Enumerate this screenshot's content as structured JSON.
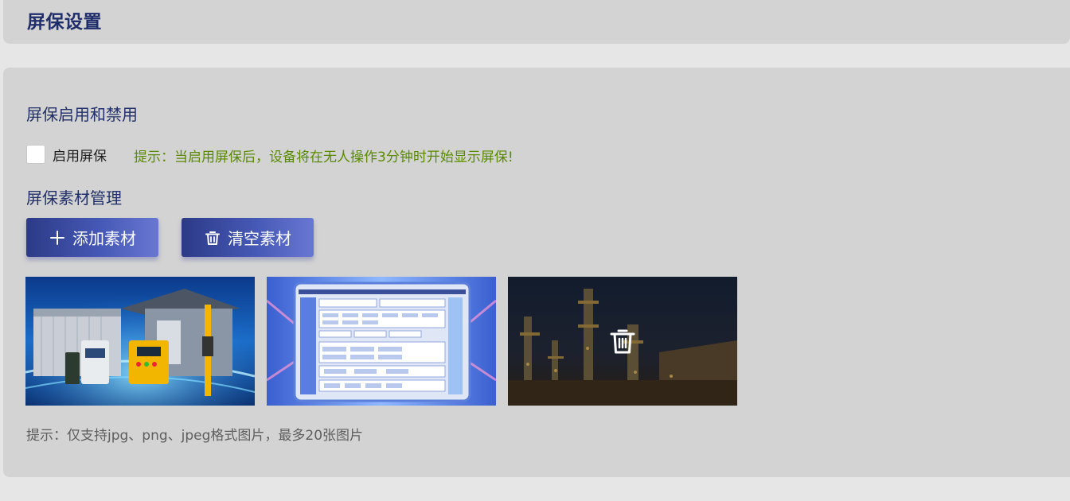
{
  "header": {
    "title": "屏保设置"
  },
  "enable_section": {
    "title": "屏保启用和禁用",
    "checkbox_label": "启用屏保",
    "checked": false,
    "tip": "提示：当启用屏保后，设备将在无人操作3分钟时开始显示屏保!"
  },
  "material_section": {
    "title": "屏保素材管理",
    "add_button": "添加素材",
    "clear_button": "清空素材",
    "images": [
      {
        "icon": "industrial-equipment-image"
      },
      {
        "icon": "platform-architecture-image"
      },
      {
        "icon": "refinery-night-image",
        "hover_icon": "trash-icon"
      }
    ],
    "tip": "提示：仅支持jpg、png、jpeg格式图片，最多20张图片"
  },
  "colors": {
    "title": "#1f2d6b",
    "tip_green": "#5a8a00",
    "button_start": "#2c3a86",
    "button_end": "#6877d2"
  }
}
